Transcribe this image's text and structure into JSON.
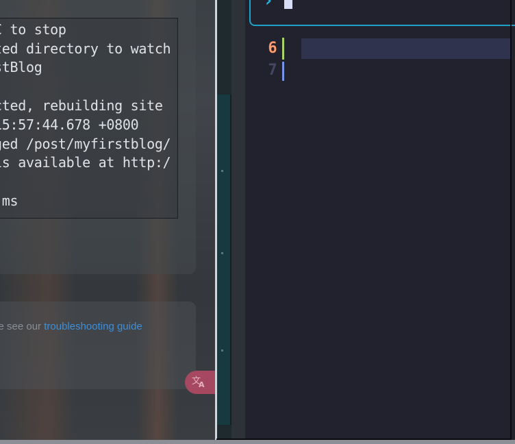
{
  "colors": {
    "link": "#3d8fd9",
    "prompt_border": "#1ea3c7",
    "line_number_current": "#ff9b6b",
    "line_number_other": "#454863",
    "git_added": "#a9d46b",
    "git_modified": "#7795e6",
    "translate_button": "#a6485f",
    "editor_background": "#22222f"
  },
  "terminal": {
    "lines": [
      "C to stop",
      "ted directory to watch",
      "stBlog",
      "",
      "cted, rebuilding site",
      "15:57:44.678 +0800",
      "ged /post/myfirstblog/",
      "is available at http:/",
      "",
      " ms"
    ]
  },
  "help": {
    "prefix": "se see our ",
    "link_text": "troubleshooting guide"
  },
  "translate_button": {
    "icon": "translate-icon"
  },
  "editor": {
    "prompt_symbol": "›",
    "line_numbers": [
      "6",
      "7"
    ],
    "current_line": "6"
  }
}
